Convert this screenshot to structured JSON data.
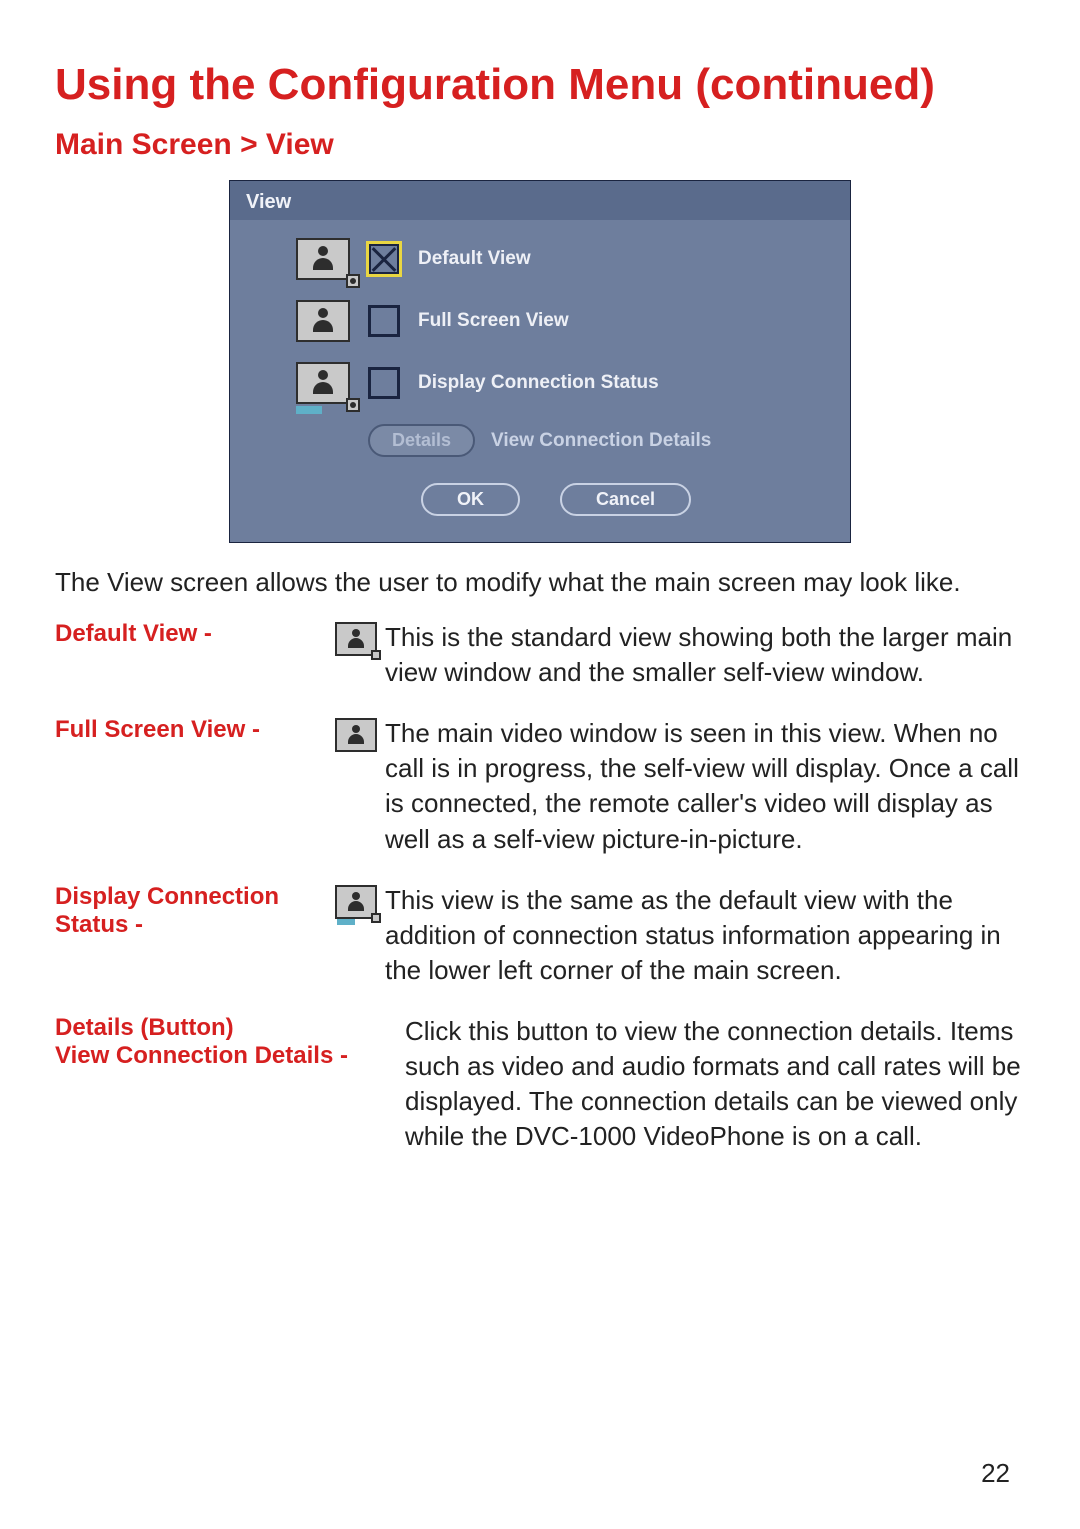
{
  "title": "Using the Configuration Menu (continued)",
  "breadcrumb": "Main Screen > View",
  "dialog": {
    "title": "View",
    "options": [
      {
        "label": "Default View",
        "checked": true
      },
      {
        "label": "Full Screen View",
        "checked": false
      },
      {
        "label": "Display Connection Status",
        "checked": false
      }
    ],
    "details_btn": "Details",
    "details_label": "View Connection Details",
    "ok": "OK",
    "cancel": "Cancel"
  },
  "intro": "The View screen allows the user to modify what the main screen may look like.",
  "definitions": [
    {
      "label": "Default View -",
      "text": "This is the standard view showing both the larger main view window and the smaller self-view window."
    },
    {
      "label": "Full Screen View -",
      "text": "The main video window is seen in this view. When no call is in progress, the self-view will display. Once a call is connected, the remote caller's video will display as well as a self-view picture-in-picture."
    },
    {
      "label": "Display Connection Status -",
      "text": "This view is the same as the default view with the addition of connection status information appearing in the lower left corner of the main screen."
    },
    {
      "label_line1": "Details (Button)",
      "label_line2": "View Connection Details -",
      "text": "Click this button to view the connection details. Items such as video and audio formats and call rates will be displayed. The connection details can be viewed only while the DVC-1000 VideoPhone is on a call."
    }
  ],
  "page_number": "22"
}
